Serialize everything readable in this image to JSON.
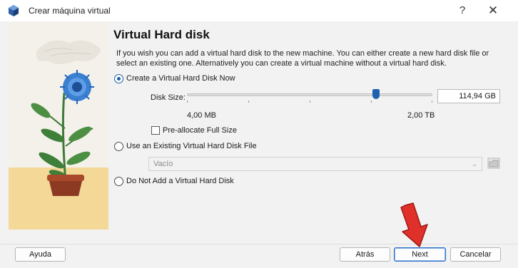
{
  "window": {
    "title": "Crear máquina virtual",
    "help_glyph": "?",
    "close_glyph": "✕"
  },
  "page": {
    "heading": "Virtual Hard disk",
    "description": "If you wish you can add a virtual hard disk to the new machine. You can either create a new hard disk file or select an existing one. Alternatively you can create a virtual machine without a virtual hard disk."
  },
  "options": {
    "create_now": {
      "label": "Create a Virtual Hard Disk Now",
      "checked": true
    },
    "disk_size_label": "Disk Size:",
    "disk_size_value": "114,94 GB",
    "slider_min": "4,00 MB",
    "slider_max": "2,00 TB",
    "slider_level_fraction": 0.77,
    "preallocate": {
      "label": "Pre-allocate Full Size",
      "checked": false
    },
    "use_existing": {
      "label": "Use an Existing Virtual Hard Disk File",
      "checked": false
    },
    "existing_combo_value": "Vacío",
    "do_not_add": {
      "label": "Do Not Add a Virtual Hard Disk",
      "checked": false
    }
  },
  "footer": {
    "help_label": "Ayuda",
    "back_label": "Atrás",
    "next_label": "Next",
    "cancel_label": "Cancelar"
  },
  "colors": {
    "accent": "#1f5fa8",
    "annotation_arrow": "#e0302a"
  }
}
